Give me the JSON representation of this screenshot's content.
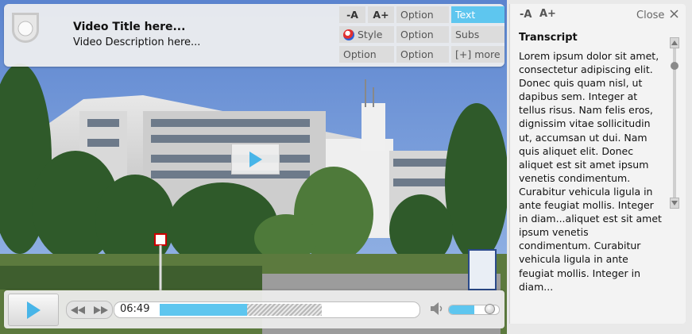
{
  "header": {
    "title": "Video Title here...",
    "description": "Video Description here..."
  },
  "options": {
    "font_smaller": "-A",
    "font_larger": "A+",
    "option": "Option",
    "text": "Text",
    "style": "Style",
    "subs": "Subs",
    "more": "[+] more"
  },
  "player": {
    "time": "06:49",
    "played_fraction": 0.34,
    "buffered_fraction": 0.63,
    "volume_fraction": 0.5
  },
  "transcript": {
    "font_smaller": "-A",
    "font_larger": "A+",
    "close_label": "Close",
    "heading": "Transcript",
    "body": "Lorem ipsum dolor sit amet, consectetur adipiscing elit. Donec quis quam nisl, ut dapibus sem. Integer at tellus risus. Nam felis eros, dignissim vitae sollicitudin ut, accumsan ut dui. Nam quis aliquet elit. Donec aliquet est sit amet ipsum venetis condimentum. Curabitur vehicula ligula in ante feugiat mollis. Integer in diam...aliquet est sit amet ipsum venetis condimentum. Curabitur vehicula ligula in ante feugiat mollis. Integer in diam..."
  },
  "colors": {
    "accent": "#5ec6ef",
    "panel": "#f0f0f0"
  }
}
